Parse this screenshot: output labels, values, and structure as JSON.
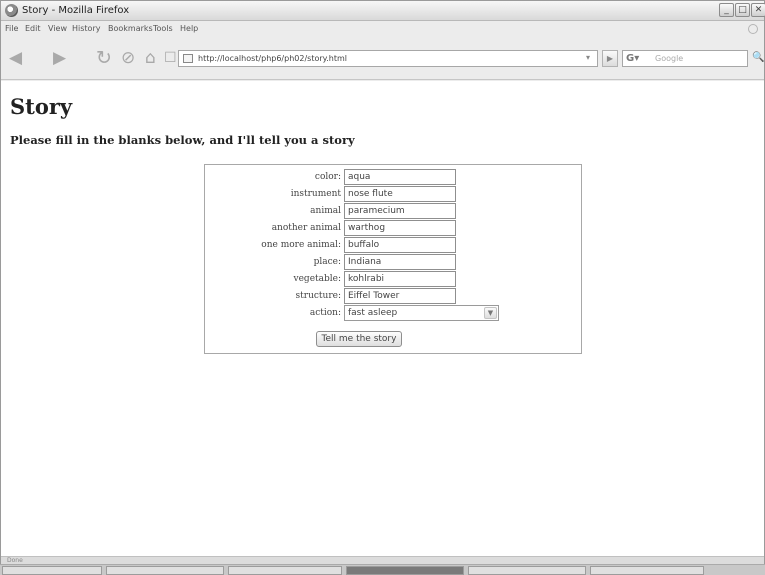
{
  "window": {
    "title": "Story - Mozilla Firefox",
    "controls": {
      "minimize": "_",
      "maximize": "□",
      "close": "✕"
    }
  },
  "menu": [
    "File",
    "Edit",
    "View",
    "History",
    "Bookmarks",
    "Tools",
    "Help"
  ],
  "nav": {
    "back": "◀",
    "forward": "▶",
    "reload": "↻",
    "stop": "⊘",
    "home": "⌂",
    "bookmark": "☐",
    "url": "http://localhost/php6/ph02/story.html",
    "url_dropdown": "▾",
    "go": "▶",
    "search_engine": "G▾",
    "search_placeholder": "Google",
    "search_go": "🔍"
  },
  "page": {
    "heading": "Story",
    "subheading": "Please fill in the blanks below, and I'll tell you a story"
  },
  "form": {
    "fields": [
      {
        "label": "color:",
        "value": "aqua"
      },
      {
        "label": "instrument",
        "value": "nose flute"
      },
      {
        "label": "animal",
        "value": "paramecium"
      },
      {
        "label": "another animal",
        "value": "warthog"
      },
      {
        "label": "one more animal:",
        "value": "buffalo"
      },
      {
        "label": "place:",
        "value": "Indiana"
      },
      {
        "label": "vegetable:",
        "value": "kohlrabi"
      },
      {
        "label": "structure:",
        "value": "Eiffel Tower"
      }
    ],
    "action_label": "action:",
    "action_value": "fast asleep",
    "submit_label": "Tell me the story"
  },
  "status": {
    "text": "Done"
  },
  "colors": {
    "chrome": "#ececec",
    "page": "#ffffff",
    "border": "#a8a8a8"
  }
}
